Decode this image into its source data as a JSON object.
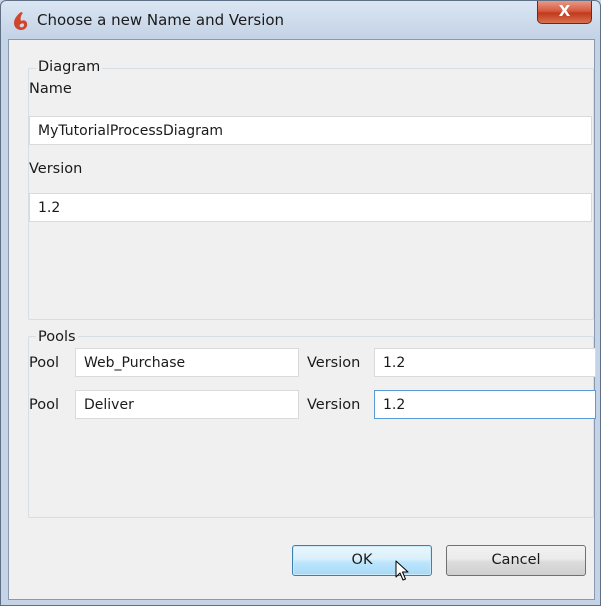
{
  "window": {
    "title": "Choose a new Name and Version",
    "close_label": "X",
    "colors": {
      "titlebar": "#c4d3e6",
      "close": "#c03a1f",
      "focus": "#5a9bd5"
    }
  },
  "diagram": {
    "group_label": "Diagram",
    "name_label": "Name",
    "name_value": "MyTutorialProcessDiagram",
    "version_label": "Version",
    "version_value": "1.2"
  },
  "pools": {
    "group_label": "Pools",
    "rows": [
      {
        "pool_label": "Pool",
        "pool_value": "Web_Purchase",
        "version_label": "Version",
        "version_value": "1.2"
      },
      {
        "pool_label": "Pool",
        "pool_value": "Deliver",
        "version_label": "Version",
        "version_value": "1.2"
      }
    ]
  },
  "buttons": {
    "ok": "OK",
    "cancel": "Cancel"
  },
  "icons": {
    "app": "bonita-swirl-icon",
    "cursor": "mouse-pointer-icon"
  }
}
